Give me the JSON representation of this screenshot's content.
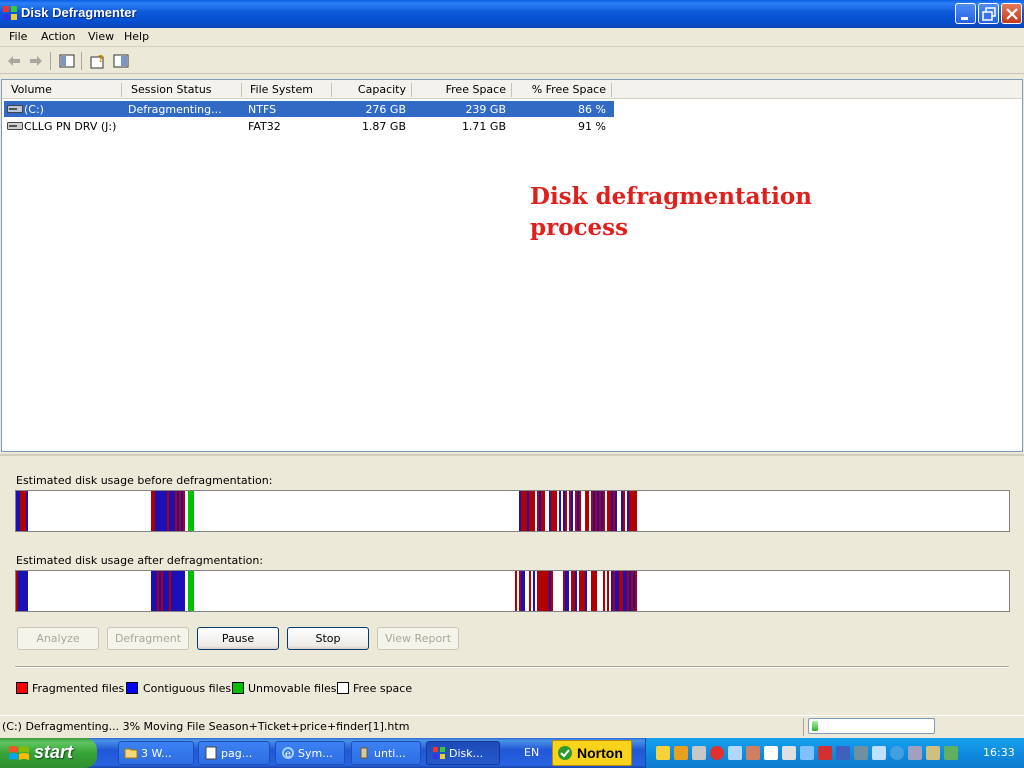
{
  "window": {
    "title": "Disk Defragmenter"
  },
  "menu": [
    "File",
    "Action",
    "View",
    "Help"
  ],
  "columns": [
    "Volume",
    "Session Status",
    "File System",
    "Capacity",
    "Free Space",
    "% Free Space"
  ],
  "volumes": [
    {
      "volume": "(C:)",
      "status": "Defragmenting...",
      "fs": "NTFS",
      "capacity": "276 GB",
      "free": "239 GB",
      "pct": "86 %"
    },
    {
      "volume": "CLLG PN DRV (J:)",
      "status": "",
      "fs": "FAT32",
      "capacity": "1.87 GB",
      "free": "1.71 GB",
      "pct": "91 %"
    }
  ],
  "annotation": {
    "line1": "Disk defragmentation",
    "line2": "process"
  },
  "analysis": {
    "before_label": "Estimated disk usage before defragmentation:",
    "after_label": "Estimated disk usage after defragmentation:"
  },
  "buttons": {
    "analyze": "Analyze",
    "defragment": "Defragment",
    "pause": "Pause",
    "stop": "Stop",
    "view_report": "View Report"
  },
  "legend": [
    {
      "label": "Fragmented files",
      "color": "#ff0000"
    },
    {
      "label": "Contiguous files",
      "color": "#0000ff"
    },
    {
      "label": "Unmovable files",
      "color": "#00c000"
    },
    {
      "label": "Free space",
      "color": "#ffffff"
    }
  ],
  "status": {
    "text": "(C:) Defragmenting... 3%  Moving File Season+Ticket+price+finder[1].htm",
    "progress": 0.03
  },
  "taskbar": {
    "start": "start",
    "tasks": [
      "3 W...",
      "pag...",
      "Sym...",
      "unti...",
      "Disk..."
    ],
    "lang": "EN",
    "norton": "Norton",
    "clock": "16:33"
  },
  "colors": {
    "fragmented": "#b00000",
    "contiguous": "#1a10b5",
    "unmovable": "#00c000",
    "selection": "#316ac5"
  }
}
